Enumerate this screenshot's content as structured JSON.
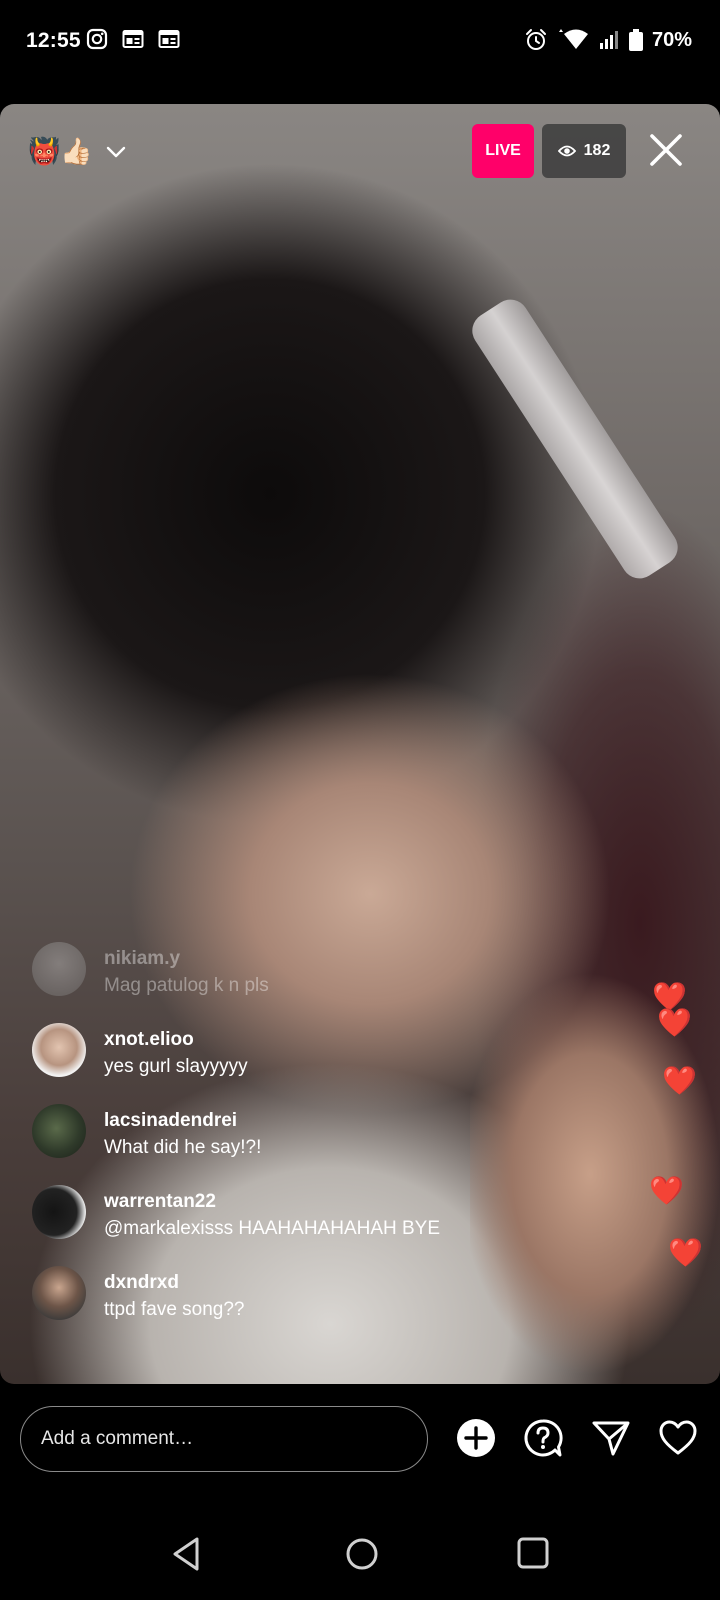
{
  "status_bar": {
    "time": "12:55",
    "battery": "70%",
    "icons_left": [
      "instagram-icon",
      "news-icon",
      "calendar-icon"
    ],
    "icons_right": [
      "alarm-icon",
      "wifi-icon",
      "signal-icon",
      "battery-icon"
    ]
  },
  "header": {
    "host_emojis": "👹👍🏻",
    "live_label": "LIVE",
    "viewer_count": "182",
    "icons": [
      "chevron-down-icon",
      "eye-icon",
      "close-icon"
    ]
  },
  "comments": [
    {
      "user": "nikiam.y",
      "message": "Mag patulog k n pls",
      "faded": true
    },
    {
      "user": "xnot.elioo",
      "message": "yes gurl slayyyyy"
    },
    {
      "user": "lacsinadendrei",
      "message": "What did he say!?!"
    },
    {
      "user": "warrentan22",
      "message": "@markalexisss HAAHAHAHAHAH BYE"
    },
    {
      "user": "dxndrxd",
      "message": "ttpd fave song??"
    }
  ],
  "hearts": [
    "❤️",
    "❤️",
    "❤️",
    "❤️",
    "❤️"
  ],
  "comment_bar": {
    "placeholder": "Add a comment…",
    "icons": [
      "add-circle-icon",
      "question-icon",
      "send-icon",
      "heart-icon"
    ]
  },
  "nav": {
    "icons": [
      "back-icon",
      "home-icon",
      "recents-icon"
    ]
  },
  "colors": {
    "live_badge": "#ff0069",
    "heart": "#e8232c",
    "background": "#000000"
  }
}
